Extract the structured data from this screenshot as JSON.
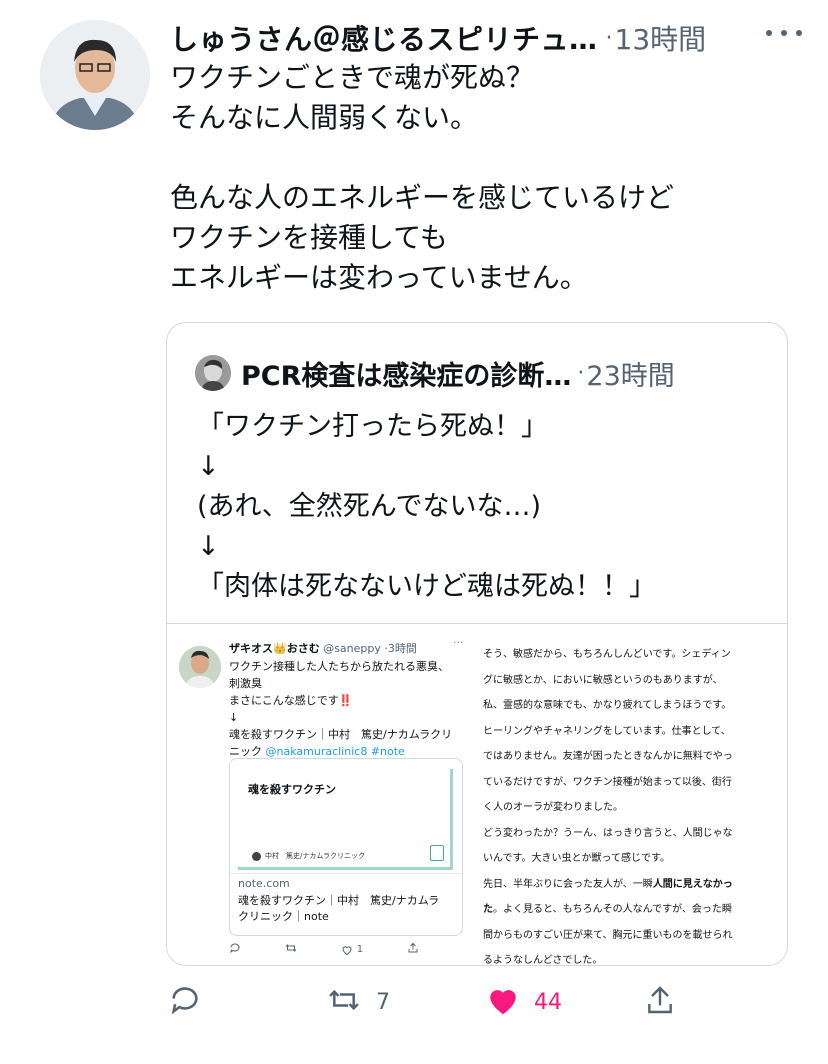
{
  "tweet": {
    "author": "しゅうさん＠感じるスピリチュ…",
    "separator": "·",
    "time": "13時間",
    "lines": [
      "ワクチンごときで魂が死ぬ？",
      "そんなに人間弱くない。",
      "",
      "色んな人のエネルギーを感じているけど",
      "ワクチンを接種しても",
      "エネルギーは変わっていません。"
    ]
  },
  "quote": {
    "author": "PCR検査は感染症の診断…",
    "separator": "·",
    "time": "23時間",
    "lines": [
      "「ワクチン打ったら死ぬ！」",
      "↓",
      "(あれ、全然死んでないな…)",
      "↓",
      "「肉体は死なないけど魂は死ぬ！！」"
    ]
  },
  "media": {
    "left": {
      "name": "ザキオス👑おさむ",
      "handle": "@saneppy",
      "time": "·3時間",
      "lines": [
        "ワクチン接種した人たちから放たれる悪臭、",
        "刺激臭",
        "まさにこんな感じです‼️",
        "↓",
        "魂を殺すワクチン｜中村　篤史/ナカムラクリ"
      ],
      "link_prefix": "ニック ",
      "link": "@nakamuraclinic8 #note",
      "card_title": "魂を殺すワクチン",
      "card_byline": "中村　篤史/ナカムラクリニック",
      "card_domain": "note.com",
      "card_desc": [
        "魂を殺すワクチン｜中村　篤史/ナカムラ",
        "クリニック｜note"
      ],
      "likes": "1"
    },
    "right": {
      "lines": [
        "そう、敏感だから、もちろんしんどいです。シェディン",
        "グに敏感とか、においに敏感というのもありますが、",
        "私、霊感的な意味でも、かなり疲れてしまうほうです。",
        "ヒーリングやチャネリングをしています。仕事として、",
        "ではありません。友達が困ったときなんかに無料でやっ",
        "ているだけですが、ワクチン接種が始まって以後、街行",
        "く人のオーラが変わりました。",
        "どう変わったか？うーん、はっきり言うと、人間じゃな",
        "いんです。大きい虫とか獣って感じです。"
      ],
      "line10_pre": "先日、半年ぶりに会った友人が、一瞬",
      "line10_bold": "人間に見えなかっ",
      "line11_bold": "た",
      "line11_post": "。よく見ると、もちろんその人なんですが、会った瞬",
      "lines_tail": [
        "間からものすごい圧が来て、胸元に重いものを載せられ",
        "るようなしんどさでした。"
      ]
    }
  },
  "actions": {
    "retweets": "7",
    "likes": "44",
    "like_color": "#f91880",
    "icons": [
      "reply-icon",
      "retweet-icon",
      "like-icon",
      "share-icon"
    ]
  }
}
